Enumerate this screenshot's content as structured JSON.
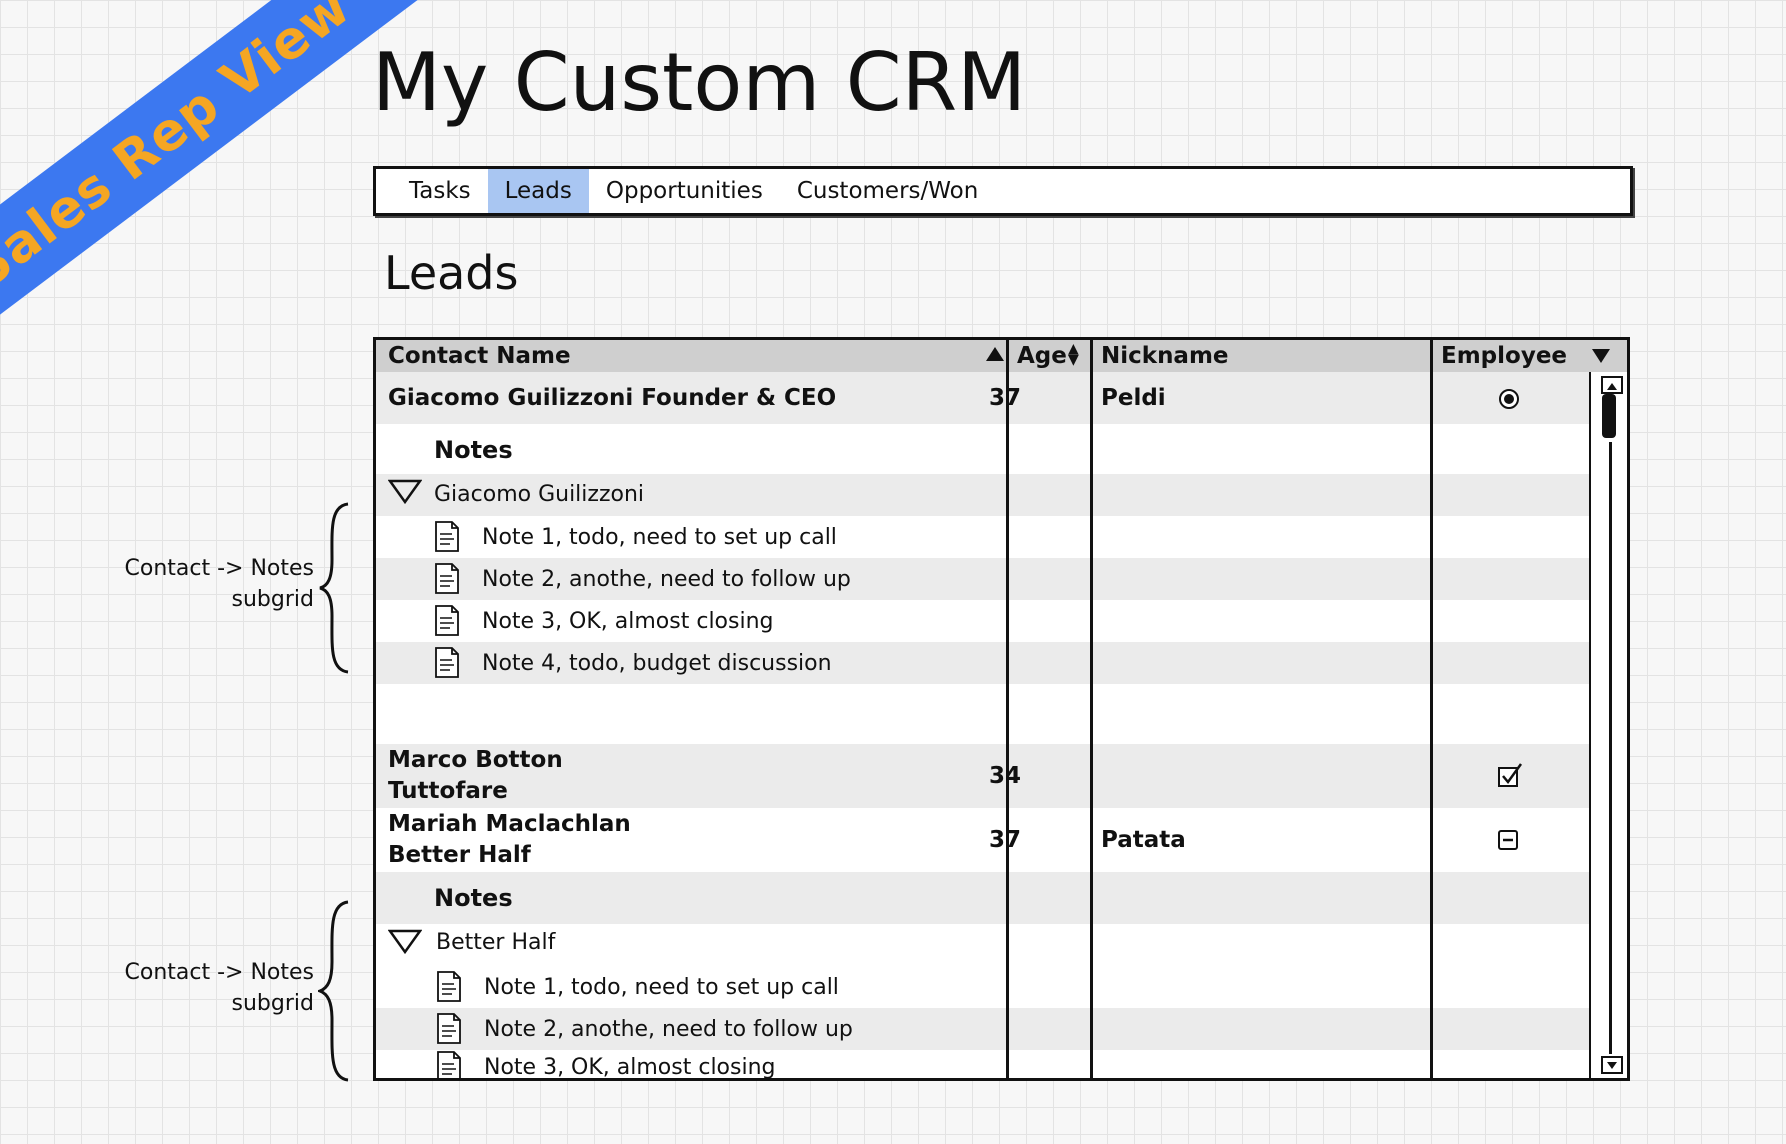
{
  "ribbon": {
    "label": "Sales Rep View"
  },
  "app": {
    "title": "My Custom CRM"
  },
  "tabs": [
    {
      "label": "Tasks",
      "active": false
    },
    {
      "label": "Leads",
      "active": true
    },
    {
      "label": "Opportunities",
      "active": false
    },
    {
      "label": "Customers/Won",
      "active": false
    }
  ],
  "section": {
    "title": "Leads"
  },
  "grid": {
    "columns": [
      "Contact Name",
      "Age",
      "Nickname",
      "Employee"
    ],
    "contacts": [
      {
        "name": "Giacomo Guilizzoni Founder & CEO",
        "age": "37",
        "nickname": "Peldi",
        "employee": "radio-selected"
      },
      {
        "name_line1": "Marco Botton",
        "name_line2": "Tuttofare",
        "age": "34",
        "nickname": "",
        "employee": "checkbox-checked"
      },
      {
        "name_line1": "Mariah Maclachlan",
        "name_line2": "Better Half",
        "age": "37",
        "nickname": "Patata",
        "employee": "checkbox-indeterminate"
      }
    ],
    "subgrids": [
      {
        "label": "Notes",
        "tree_label": "Giacomo Guilizzoni",
        "notes": [
          "Note 1, todo, need to set up call",
          "Note 2, anothe, need to follow up",
          "Note 3, OK, almost closing",
          "Note 4, todo, budget discussion"
        ]
      },
      {
        "label": "Notes",
        "tree_label": "Better Half",
        "notes": [
          "Note 1, todo, need to set up call",
          "Note 2, anothe, need to follow up",
          "Note 3, OK, almost closing"
        ]
      }
    ]
  },
  "annotations": [
    {
      "line1": "Contact -> Notes",
      "line2": "subgrid"
    },
    {
      "line1": "Contact -> Notes",
      "line2": "subgrid"
    }
  ]
}
